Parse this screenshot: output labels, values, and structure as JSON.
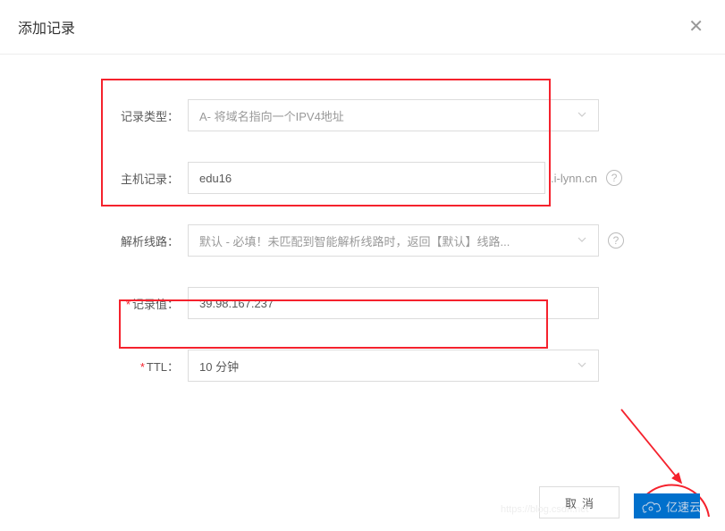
{
  "header": {
    "title": "添加记录",
    "close": "✕"
  },
  "form": {
    "type": {
      "label": "记录类型：",
      "value": "A- 将域名指向一个IPV4地址"
    },
    "host": {
      "label": "主机记录：",
      "value": "edu16",
      "suffix": ".i-lynn.cn"
    },
    "line": {
      "label": "解析线路：",
      "value": "默认 - 必填！未匹配到智能解析线路时，返回【默认】线路..."
    },
    "recordValue": {
      "label": "记录值：",
      "value": "39.98.167.237"
    },
    "ttl": {
      "label": "TTL：",
      "value": "10 分钟"
    }
  },
  "footer": {
    "cancel": "取消"
  },
  "watermark": {
    "brand": "亿速云",
    "blog": "https://blog.csdn.net"
  }
}
